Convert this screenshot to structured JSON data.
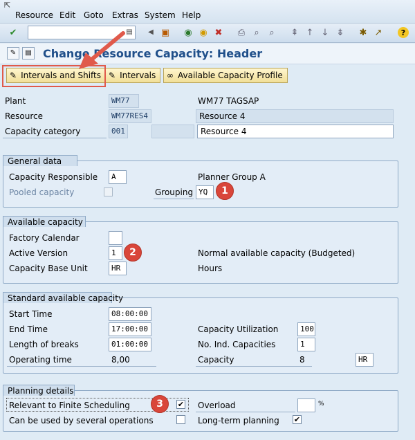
{
  "menu": {
    "items": [
      "Resource",
      "Edit",
      "Goto",
      "Extras",
      "System",
      "Help"
    ]
  },
  "title": "Change Resource Capacity: Header",
  "buttons": {
    "intervals_shifts": "Intervals and Shifts",
    "intervals": "Intervals",
    "avail_profile": "Available Capacity Profile"
  },
  "header": {
    "plant_label": "Plant",
    "plant_value": "WM77",
    "plant_desc": "WM77 TAGSAP",
    "resource_label": "Resource",
    "resource_value": "WM77RES4",
    "resource_desc": "Resource 4",
    "capcat_label": "Capacity category",
    "capcat_value": "001",
    "capcat_desc": "Resource 4"
  },
  "general": {
    "title": "General data",
    "cap_resp_label": "Capacity Responsible",
    "cap_resp_value": "A",
    "cap_resp_desc": "Planner Group A",
    "pooled_label": "Pooled capacity",
    "grouping_label": "Grouping",
    "grouping_value": "YQ"
  },
  "available": {
    "title": "Available capacity",
    "factory_label": "Factory Calendar",
    "factory_value": "",
    "active_label": "Active Version",
    "active_value": "1",
    "active_desc": "Normal available capacity (Budgeted)",
    "base_unit_label": "Capacity Base Unit",
    "base_unit_value": "HR",
    "base_unit_desc": "Hours"
  },
  "standard": {
    "title": "Standard available capacity",
    "start_label": "Start Time",
    "start_value": "08:00:00",
    "end_label": "End Time",
    "end_value": "17:00:00",
    "breaks_label": "Length of breaks",
    "breaks_value": "01:00:00",
    "optime_label": "Operating time",
    "optime_value": "8,00",
    "util_label": "Capacity Utilization",
    "util_value": "100",
    "ind_label": "No. Ind. Capacities",
    "ind_value": "1",
    "cap_label": "Capacity",
    "cap_value": "8",
    "cap_unit": "HR"
  },
  "planning": {
    "title": "Planning details",
    "finite_label": "Relevant to Finite Scheduling",
    "several_label": "Can be used by several operations",
    "overload_label": "Overload",
    "overload_value": "",
    "overload_unit": "%",
    "longterm_label": "Long-term planning",
    "check_mark": "✔"
  },
  "annotations": {
    "b1": "1",
    "b2": "2",
    "b3": "3"
  },
  "colors": {
    "title": "#1f4f8a",
    "badge": "#d9463a",
    "highlight": "#e05a4b"
  }
}
